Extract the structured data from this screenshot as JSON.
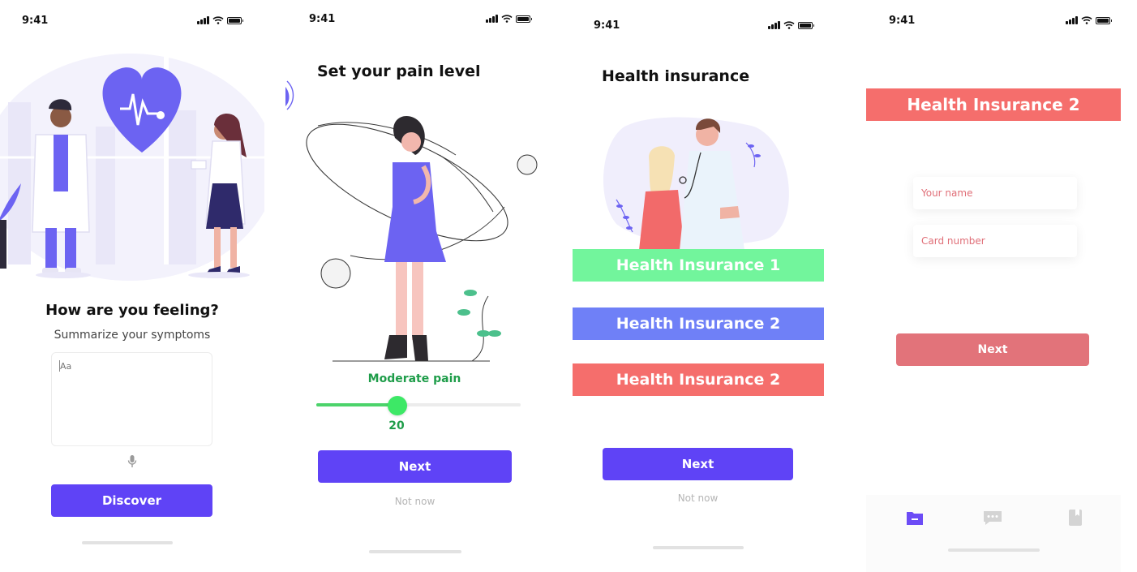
{
  "screens": [
    {
      "time": "9:41",
      "title": "How are you feeling?",
      "subtitle": "Summarize your symptoms",
      "symptom_placeholder": "Aa",
      "button": "Discover"
    },
    {
      "time": "9:41",
      "title": "Set your pain level",
      "pain_label": "Moderate pain",
      "pain_value": "20",
      "pain_fraction": 0.4,
      "button": "Next",
      "secondary": "Not now"
    },
    {
      "time": "9:41",
      "title": "Health insurance",
      "options": [
        "Health Insurance 1",
        "Health Insurance 2",
        "Health Insurance 2"
      ],
      "button": "Next",
      "secondary": "Not now"
    },
    {
      "time": "9:41",
      "banner": "Health Insurance 2",
      "name_placeholder": "Your name",
      "card_placeholder": "Card number",
      "button": "Next",
      "tabs": [
        "folder-icon",
        "chat-icon",
        "bookmark-icon"
      ]
    }
  ],
  "colors": {
    "primary": "#5f43f6",
    "insurance_green": "#72f59c",
    "insurance_blue": "#6f80f7",
    "insurance_red": "#f56e6c",
    "pain_green": "#1f9d4a",
    "next_red": "#e2737a"
  }
}
